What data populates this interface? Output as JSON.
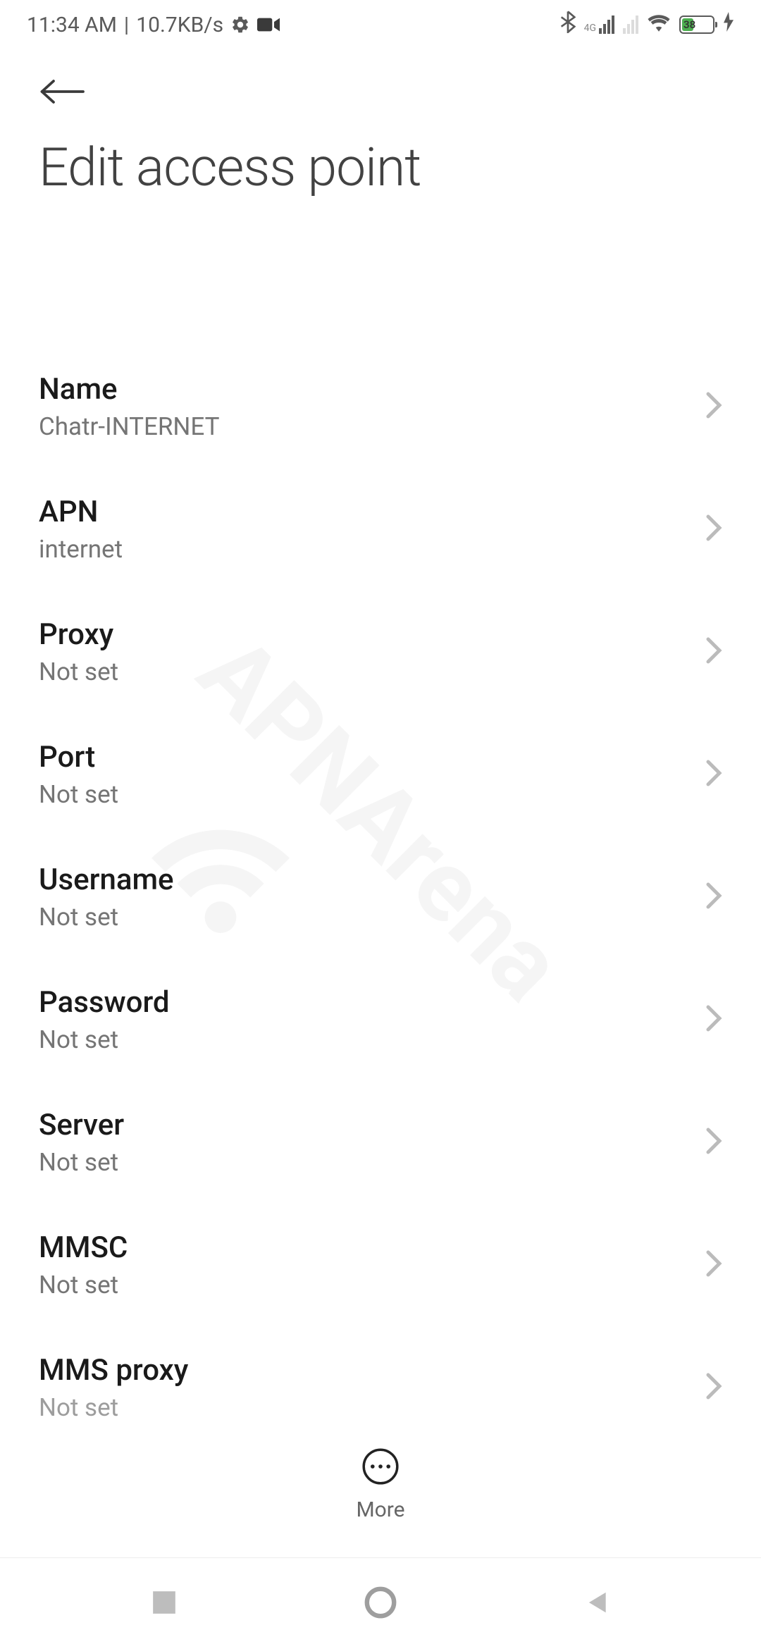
{
  "status": {
    "time": "11:34 AM",
    "speed": "10.7KB/s",
    "battery": "38",
    "network_label": "4G"
  },
  "header": {
    "title": "Edit access point"
  },
  "settings": [
    {
      "label": "Name",
      "value": "Chatr-INTERNET"
    },
    {
      "label": "APN",
      "value": "internet"
    },
    {
      "label": "Proxy",
      "value": "Not set"
    },
    {
      "label": "Port",
      "value": "Not set"
    },
    {
      "label": "Username",
      "value": "Not set"
    },
    {
      "label": "Password",
      "value": "Not set"
    },
    {
      "label": "Server",
      "value": "Not set"
    },
    {
      "label": "MMSC",
      "value": "Not set"
    },
    {
      "label": "MMS proxy",
      "value": "Not set"
    }
  ],
  "bottom": {
    "more_label": "More"
  },
  "watermark": "APNArena"
}
